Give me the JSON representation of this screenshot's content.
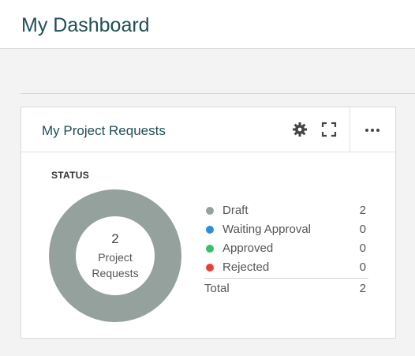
{
  "header": {
    "title": "My Dashboard"
  },
  "widget": {
    "title": "My Project Requests",
    "icons": {
      "settings": "gear-icon",
      "expand": "expand-icon",
      "more": "more-icon"
    },
    "section_label": "STATUS",
    "donut": {
      "count": "2",
      "label_line1": "Project",
      "label_line2": "Requests",
      "color": "#95a19d"
    },
    "legend": [
      {
        "name": "Draft",
        "value": "2",
        "color": "#95a19d"
      },
      {
        "name": "Waiting Approval",
        "value": "0",
        "color": "#2e8fd6"
      },
      {
        "name": "Approved",
        "value": "0",
        "color": "#35c06a"
      },
      {
        "name": "Rejected",
        "value": "0",
        "color": "#e8413a"
      }
    ],
    "total": {
      "name": "Total",
      "value": "2"
    }
  }
}
